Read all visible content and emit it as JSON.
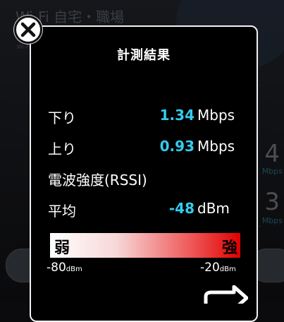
{
  "background": {
    "title": "Wi-Fi 自宅・職場",
    "sub_label": "Wi-Fi",
    "speed_values": [
      "4",
      "3"
    ],
    "speed_units": [
      "Mbps",
      "Mbps"
    ]
  },
  "dialog": {
    "title": "計測結果",
    "download": {
      "label": "下り",
      "value": "1.34",
      "unit": "Mbps"
    },
    "upload": {
      "label": "上り",
      "value": "0.93",
      "unit": "Mbps"
    },
    "rssi_heading": "電波強度(RSSI)",
    "average": {
      "label": "平均",
      "value": "-48",
      "unit": "dBm"
    },
    "gauge": {
      "weak_label": "弱",
      "strong_label": "強",
      "min_value": "-80",
      "min_unit": "dBm",
      "max_value": "-20",
      "max_unit": "dBm",
      "colors": {
        "start": "#ffffff",
        "end": "#e00000"
      }
    }
  },
  "colors": {
    "accent_value": "#33ccee",
    "border": "#f2f2f2"
  },
  "icons": {
    "close": "close-icon",
    "share": "share-icon"
  }
}
